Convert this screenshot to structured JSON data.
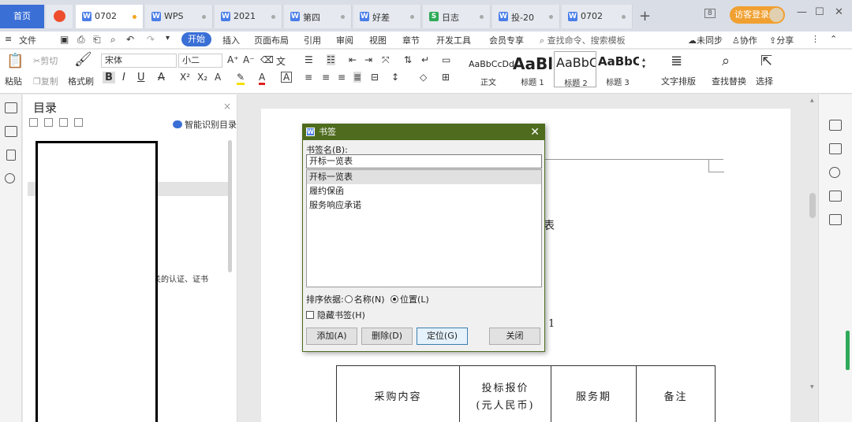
{
  "tabbar": {
    "home": "首页",
    "tabs": [
      {
        "label": "0702",
        "active": true
      },
      {
        "label": "WPS",
        "active": false
      },
      {
        "label": "2021",
        "active": false
      },
      {
        "label": "第四",
        "active": false
      },
      {
        "label": "好差",
        "active": false
      },
      {
        "label": "日志",
        "active": false,
        "type": "sheet"
      },
      {
        "label": "投-20",
        "active": false
      },
      {
        "label": "0702",
        "active": false
      }
    ],
    "tab_icon_letter": "W",
    "sheet_icon_letter": "S",
    "plus": "+",
    "badge": "8",
    "guest_login": "访客登录",
    "minimize": "—",
    "maximize": "☐",
    "close": "✕"
  },
  "menubar": {
    "hamburger": "≡",
    "file": "文件",
    "start": "开始",
    "items": [
      "插入",
      "页面布局",
      "引用",
      "审阅",
      "视图",
      "章节",
      "开发工具",
      "会员专享"
    ],
    "search_placeholder": "查找命令、搜索模板",
    "unsync": "未同步",
    "collab": "协作",
    "share": "分享"
  },
  "ribbon": {
    "paste": "粘贴",
    "cut": "剪切",
    "copy": "复制",
    "format_painter": "格式刷",
    "font": "宋体",
    "size": "小二",
    "styles": [
      {
        "sample": "AaBbCcDd",
        "name": "正文"
      },
      {
        "sample": "AaBl",
        "name": "标题 1"
      },
      {
        "sample": "AaBbC",
        "name": "标题 2"
      },
      {
        "sample": "AaBbC",
        "name": "标题 3"
      }
    ],
    "text_layout": "文字排版",
    "find_replace": "查找替换",
    "select": "选择"
  },
  "toc": {
    "title": "目录",
    "close": "×",
    "smart": "智能识别目录",
    "partial_item": "关的认证、证书"
  },
  "document": {
    "fragment": "表",
    "page_number": "1",
    "table_headers": [
      "采购内容",
      "投标报价\n(元人民币)",
      "服务期",
      "备注"
    ]
  },
  "dialog": {
    "title": "书签",
    "title_icon": "W",
    "close": "✕",
    "name_label": "书签名(B):",
    "name_value": "开标一览表",
    "bookmarks": [
      "开标一览表",
      "履约保函",
      "服务响应承诺"
    ],
    "sort_label": "排序依据:",
    "sort_name": "名称(N)",
    "sort_position": "位置(L)",
    "sort_selected": "position",
    "hide_label": "隐藏书签(H)",
    "hide_checked": false,
    "buttons": {
      "add": "添加(A)",
      "delete": "删除(D)",
      "goto": "定位(G)",
      "close": "关闭"
    }
  }
}
